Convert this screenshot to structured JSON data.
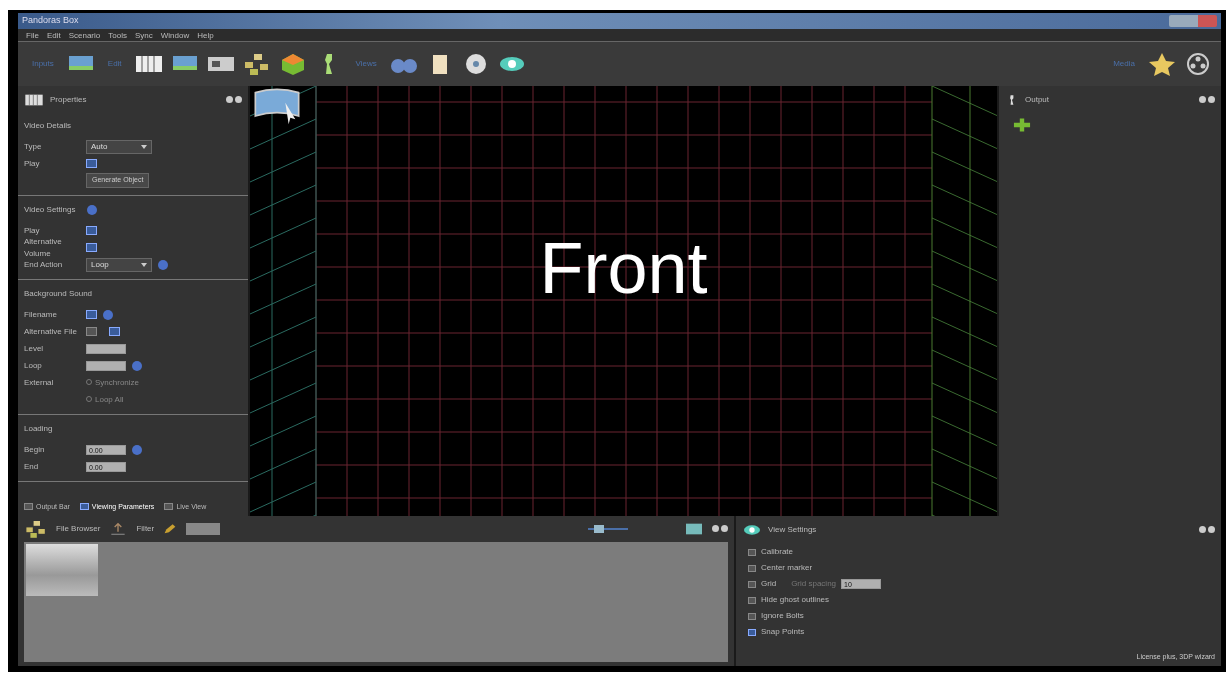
{
  "window": {
    "title": "Pandoras Box"
  },
  "menu": [
    "File",
    "Edit",
    "Scenario",
    "Tools",
    "Sync",
    "Window",
    "Help"
  ],
  "toolbar": {
    "groups": [
      {
        "label": "Inputs",
        "icons": [
          {
            "kind": "screen"
          }
        ]
      },
      {
        "label": "Edit",
        "icons": [
          {
            "kind": "grid"
          },
          {
            "kind": "screen"
          },
          {
            "kind": "panel"
          },
          {
            "kind": "tree"
          },
          {
            "kind": "cube"
          },
          {
            "kind": "figure"
          }
        ]
      },
      {
        "label": "Views",
        "icons": [
          {
            "kind": "binoculars"
          },
          {
            "kind": "clipboard"
          },
          {
            "kind": "disc"
          },
          {
            "kind": "eye"
          }
        ]
      }
    ],
    "right_group": {
      "label": "Media",
      "icons": [
        {
          "kind": "star"
        },
        {
          "kind": "reel"
        }
      ]
    }
  },
  "properties": {
    "title": "Properties",
    "sections": [
      {
        "title": "Video Details",
        "info": false,
        "rows": [
          {
            "kind": "select",
            "label": "Type",
            "value": "Auto"
          },
          {
            "kind": "check",
            "label": "Play",
            "checked": true
          },
          {
            "kind": "button",
            "label": "Generate Object"
          }
        ]
      },
      {
        "title": "Video Settings",
        "info": true,
        "rows": [
          {
            "kind": "check",
            "label": "Play",
            "checked": true
          },
          {
            "kind": "check",
            "label": "Alternative Volume",
            "checked": true
          },
          {
            "kind": "select",
            "label": "End Action",
            "value": "Loop",
            "info": true
          }
        ]
      },
      {
        "title": "Background Sound",
        "info": false,
        "rows": [
          {
            "kind": "check",
            "label": "Filename",
            "checked": true,
            "info": true
          },
          {
            "kind": "check2",
            "label": "Alternative File",
            "boxes": [
              {
                "checked": false
              },
              {
                "checked": true
              }
            ]
          },
          {
            "kind": "spin",
            "label": "Level"
          },
          {
            "kind": "spin",
            "label": "Loop",
            "info": true
          },
          {
            "kind": "radio",
            "label": "External",
            "value": "Synchronize"
          },
          {
            "kind": "radio",
            "label": "",
            "value": "Loop All"
          }
        ]
      },
      {
        "title": "Loading",
        "info": false,
        "rows": [
          {
            "kind": "spin",
            "label": "Begin",
            "value": "0.00",
            "info": true
          },
          {
            "kind": "spin",
            "label": "End",
            "value": "0.00"
          }
        ]
      }
    ],
    "tabs": [
      {
        "label": "Output Bar",
        "selected": false
      },
      {
        "label": "Viewing Parameters",
        "selected": true
      },
      {
        "label": "Live View",
        "selected": false
      }
    ]
  },
  "viewport": {
    "label": "Front"
  },
  "object_panel": {
    "title": "Output"
  },
  "file_browser": {
    "title": "File Browser",
    "filter_label": "Filter",
    "zoom_slider": {
      "level": 0.2
    }
  },
  "view_settings": {
    "title": "View Settings",
    "options": [
      {
        "label": "Calibrate",
        "checked": false
      },
      {
        "label": "Center marker",
        "checked": false
      },
      {
        "label": "Grid",
        "checked": false,
        "extra": "Grid spacing",
        "value": "10"
      },
      {
        "label": "Hide ghost outlines",
        "checked": false
      },
      {
        "label": "Ignore Bolts",
        "checked": false
      },
      {
        "label": "Snap Points",
        "checked": true
      }
    ]
  },
  "status_bar": "License plus, 3DP wizard"
}
